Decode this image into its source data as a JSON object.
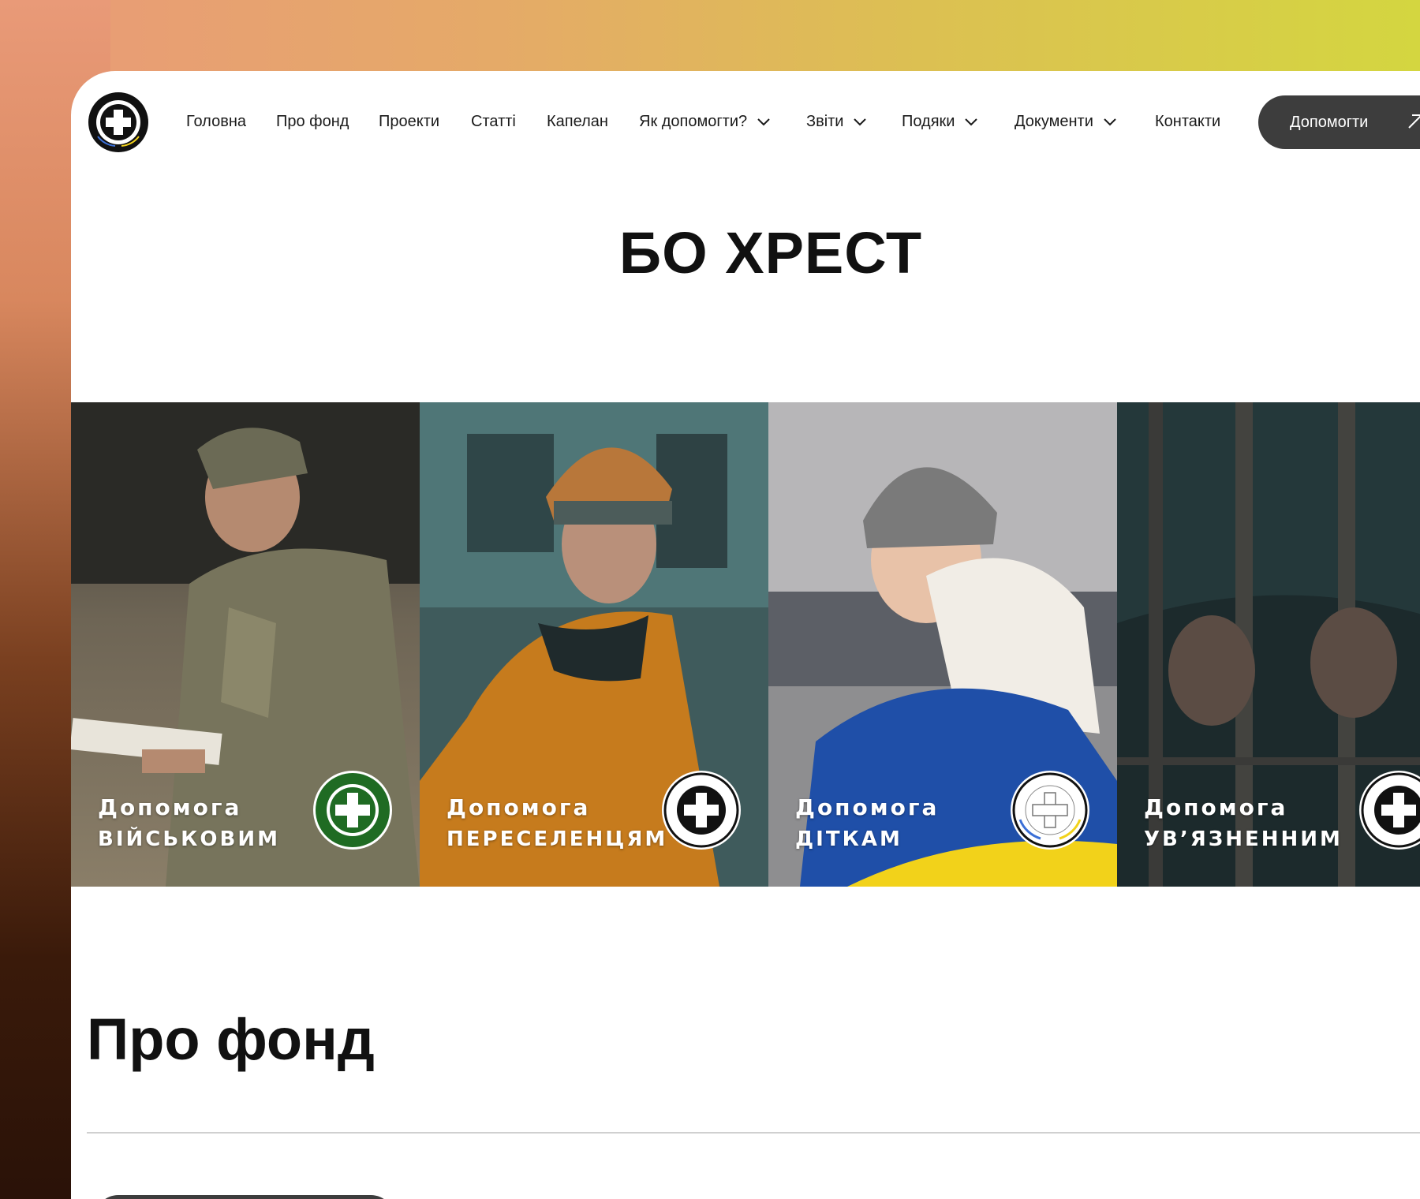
{
  "nav": {
    "logo_alt": "БЛАГОДІЙНИЙ ФОНД ХРЕСТ",
    "items": [
      {
        "label": "Головна"
      },
      {
        "label": "Про фонд"
      },
      {
        "label": "Проекти"
      },
      {
        "label": "Статті"
      },
      {
        "label": "Капелан"
      },
      {
        "label": "Як допомогти?"
      },
      {
        "label": "Звіти"
      },
      {
        "label": "Подяки"
      },
      {
        "label": "Документи"
      },
      {
        "label": "Контакти"
      }
    ],
    "cta_label": "Допомогти"
  },
  "hero": {
    "title": "БО ХРЕСТ"
  },
  "cards": [
    {
      "line1": "Допомога",
      "line2": "військовим",
      "badge_color": "#1f6b23"
    },
    {
      "line1": "Допомога",
      "line2": "переселенцям",
      "badge_color": "#111111"
    },
    {
      "line1": "Допомога",
      "line2": "діткам",
      "badge_color": "#ffffff"
    },
    {
      "line1": "Допомога",
      "line2": "ув’язненним",
      "badge_color": "#111111"
    }
  ],
  "about": {
    "title": "Про фонд"
  },
  "colors": {
    "button_bg": "#3d3d3d",
    "ukraine_blue": "#1f4fa8",
    "ukraine_yellow": "#f2d21a"
  }
}
